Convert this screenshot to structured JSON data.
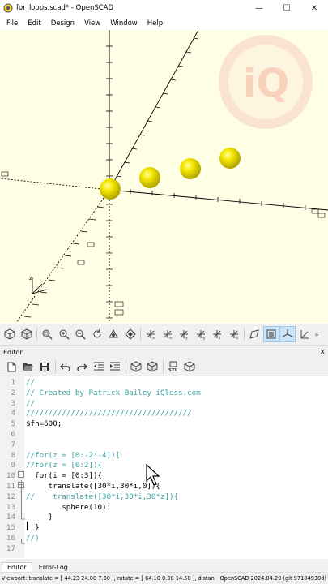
{
  "window": {
    "title": "for_loops.scad* - OpenSCAD",
    "minimize": "—",
    "maximize": "☐",
    "close": "✕"
  },
  "menu": [
    "File",
    "Edit",
    "Design",
    "View",
    "Window",
    "Help"
  ],
  "watermark": {
    "text": "iQ"
  },
  "axis_labels": {
    "z": "z"
  },
  "editor": {
    "title": "Editor",
    "close": "x",
    "lines": [
      {
        "num": "1",
        "text": "//",
        "kind": "comment"
      },
      {
        "num": "2",
        "text": "// Created by Patrick Bailey iQless.com",
        "kind": "comment"
      },
      {
        "num": "3",
        "text": "//",
        "kind": "comment"
      },
      {
        "num": "4",
        "text": "/////////////////////////////////////",
        "kind": "comment"
      },
      {
        "num": "5",
        "text": "$fn=600;",
        "kind": "code"
      },
      {
        "num": "6",
        "text": "",
        "kind": "code"
      },
      {
        "num": "7",
        "text": "",
        "kind": "code"
      },
      {
        "num": "8",
        "text": "//for(z = [0:-2:-4]){",
        "kind": "comment"
      },
      {
        "num": "9",
        "text": "//for(z = [0:2]){",
        "kind": "comment"
      },
      {
        "num": "10",
        "text": "  for(i = [0:3]){",
        "kind": "code"
      },
      {
        "num": "11",
        "text": "     translate([30*i,30*i,0]){",
        "kind": "code"
      },
      {
        "num": "12",
        "text": "//    translate([30*i,30*i,30*z]){",
        "kind": "comment"
      },
      {
        "num": "13",
        "text": "        sphere(10);",
        "kind": "code"
      },
      {
        "num": "14",
        "text": "     }",
        "kind": "code"
      },
      {
        "num": "15",
        "text": "  }",
        "kind": "code"
      },
      {
        "num": "16",
        "text": "//)",
        "kind": "comment"
      },
      {
        "num": "17",
        "text": "",
        "kind": "code"
      }
    ]
  },
  "tabs": [
    "Editor",
    "Error-Log"
  ],
  "status": {
    "text": "Viewport: translate = [ 44.23 24.00 7.60 ], rotate = [ 64.10 0.00 14.50 ], distan",
    "version": "OpenSCAD 2024.04.29 (git 97184930d)"
  },
  "colors": {
    "viewport_bg": "#ffffe5",
    "sphere": "#f0e000",
    "comment": "#3aa3a3"
  }
}
